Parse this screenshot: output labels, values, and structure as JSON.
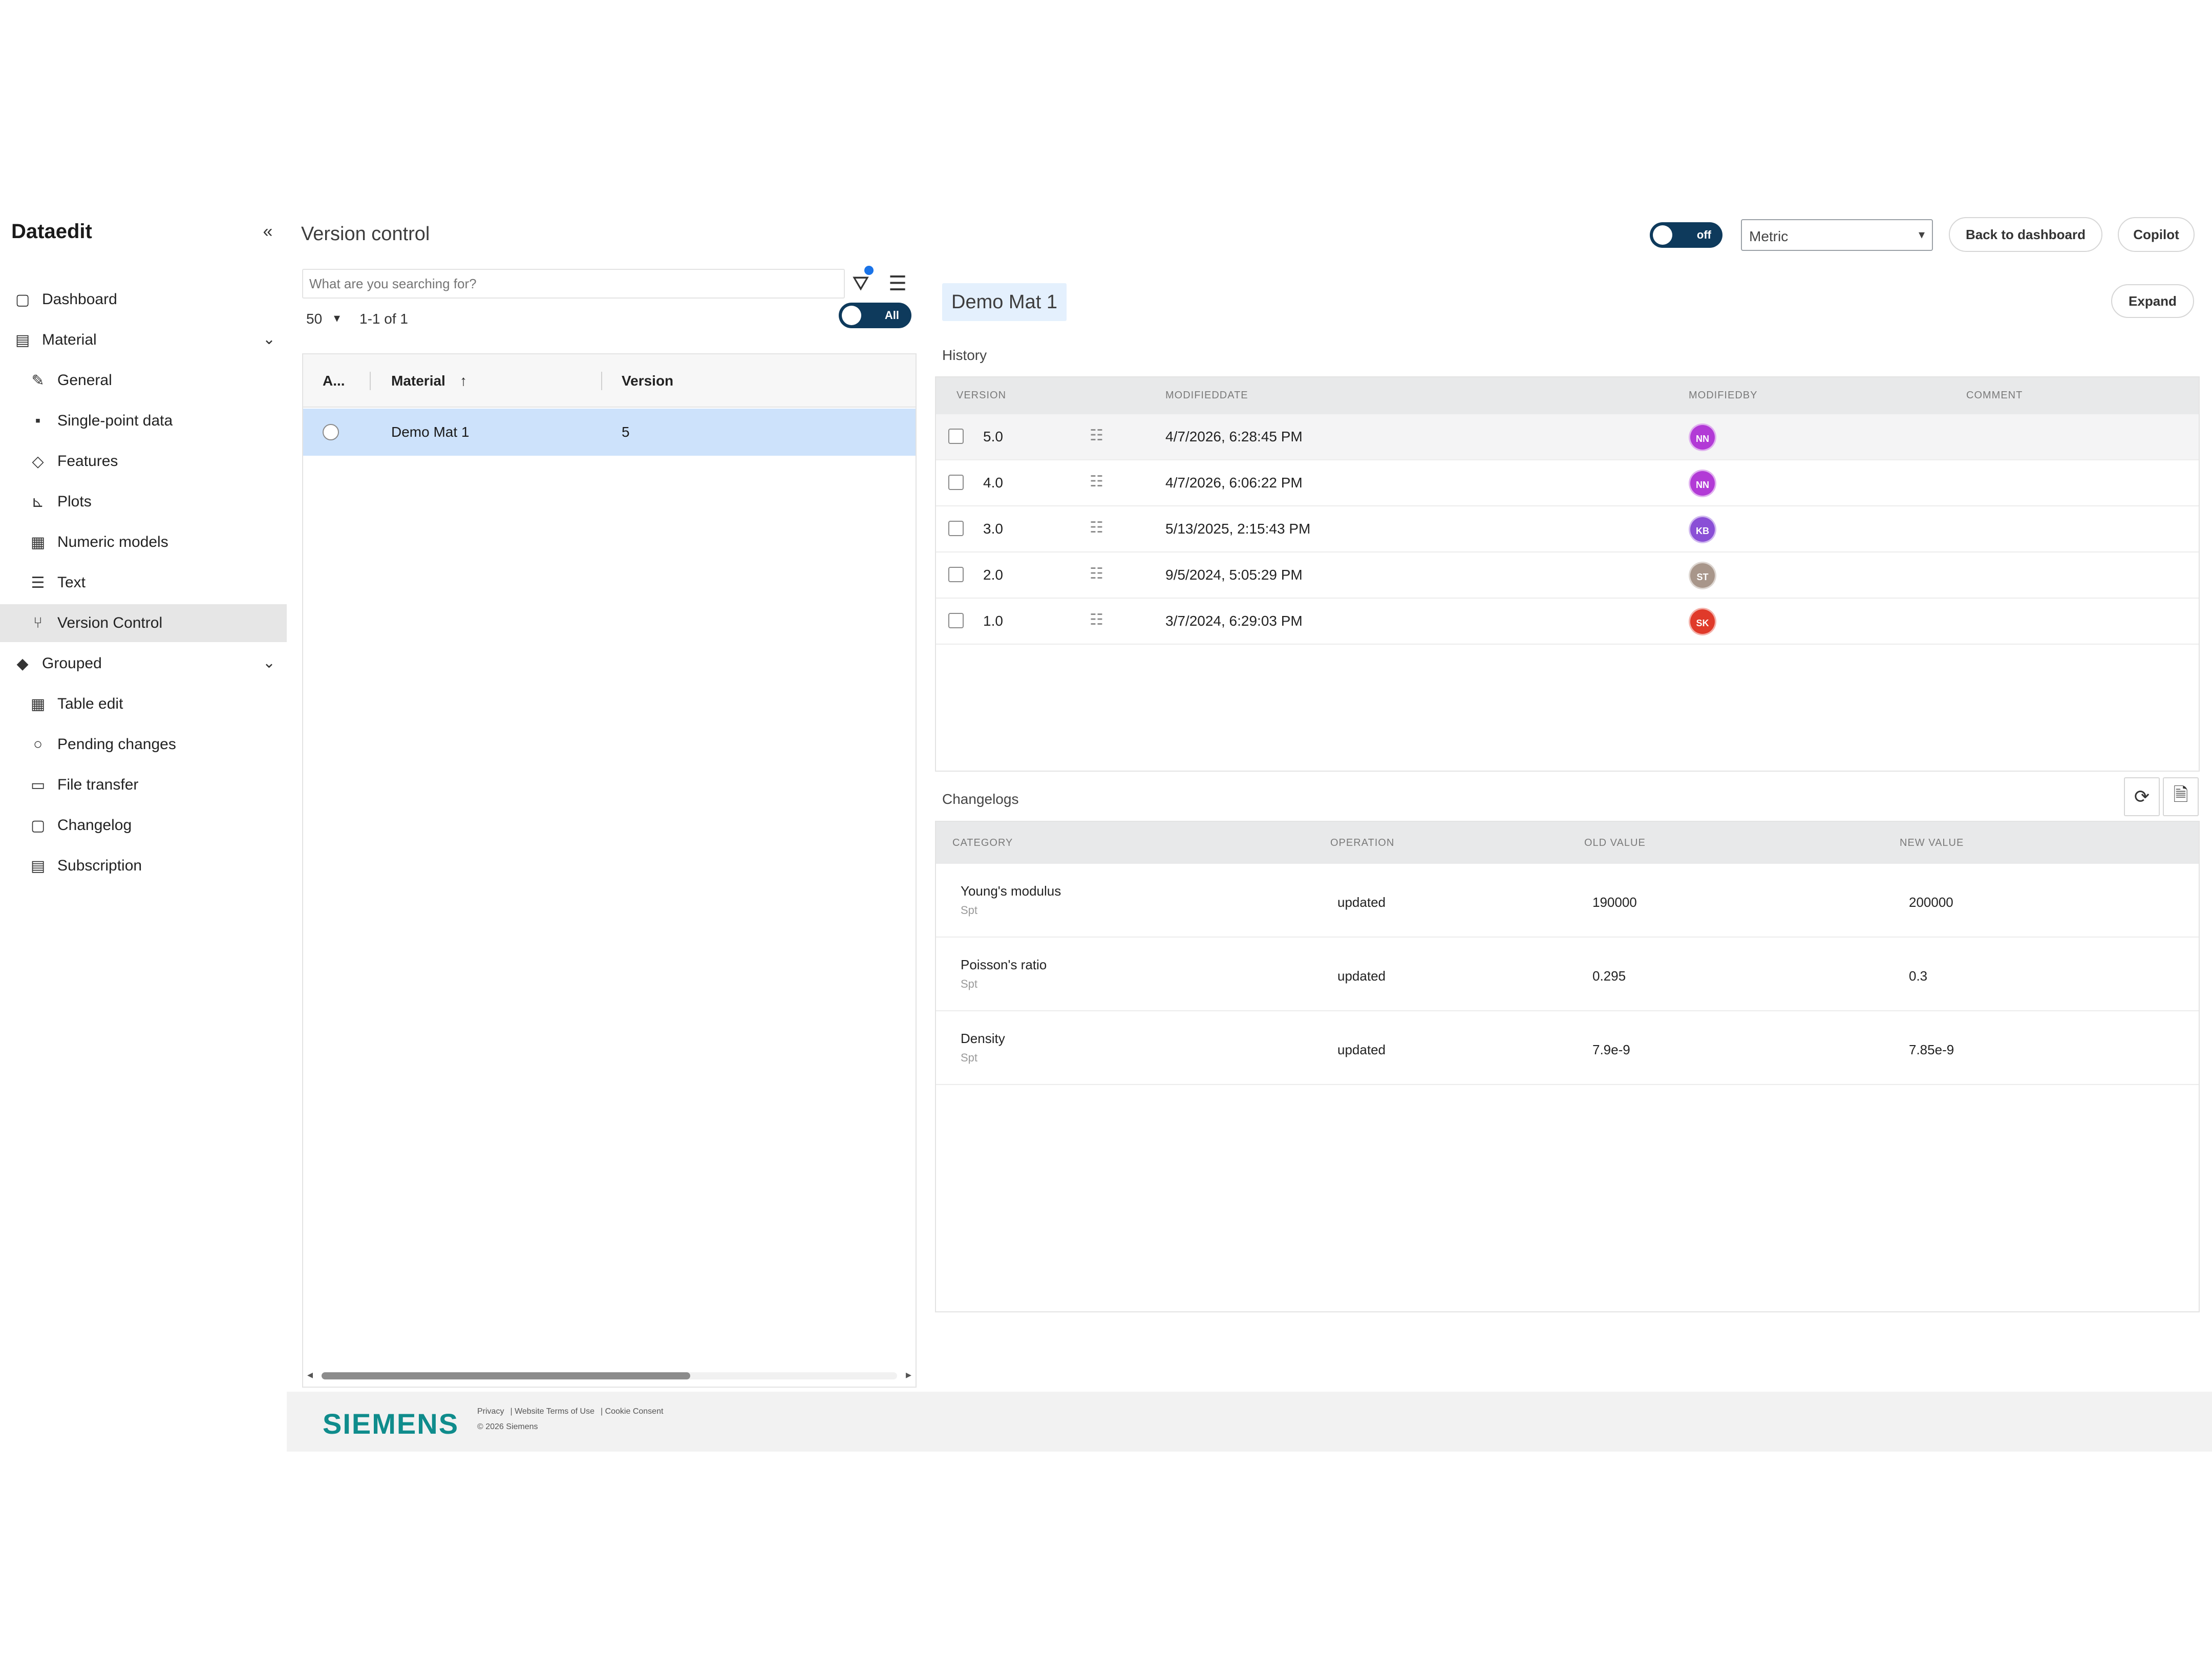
{
  "app": {
    "brand": "Dataedit",
    "collapse_icon": "double-chevron-left-icon"
  },
  "sidebar": {
    "items": [
      {
        "label": "Dashboard",
        "icon": "dashboard-icon",
        "level": "top"
      },
      {
        "label": "Material",
        "icon": "material-icon",
        "level": "top",
        "expandable": true
      },
      {
        "label": "General",
        "icon": "pencil-icon",
        "level": "sub"
      },
      {
        "label": "Single-point data",
        "icon": "point-icon",
        "level": "sub"
      },
      {
        "label": "Features",
        "icon": "tag-icon",
        "level": "sub"
      },
      {
        "label": "Plots",
        "icon": "plot-icon",
        "level": "sub"
      },
      {
        "label": "Numeric models",
        "icon": "numeric-icon",
        "level": "sub"
      },
      {
        "label": "Text",
        "icon": "text-icon",
        "level": "sub"
      },
      {
        "label": "Version Control",
        "icon": "branch-icon",
        "level": "sub",
        "active": true
      },
      {
        "label": "Grouped",
        "icon": "group-icon",
        "level": "top",
        "expandable": true
      },
      {
        "label": "Table edit",
        "icon": "table-icon",
        "level": "sub"
      },
      {
        "label": "Pending changes",
        "icon": "pending-icon",
        "level": "sub"
      },
      {
        "label": "File transfer",
        "icon": "folder-icon",
        "level": "sub"
      },
      {
        "label": "Changelog",
        "icon": "changelog-icon",
        "level": "sub"
      },
      {
        "label": "Subscription",
        "icon": "subscription-icon",
        "level": "sub"
      }
    ]
  },
  "header": {
    "title": "Version control",
    "toggle_label": "off",
    "unit_select": "Metric",
    "back_button": "Back to dashboard",
    "copilot_button": "Copilot"
  },
  "list": {
    "search_placeholder": "What are you searching for?",
    "page_size": "50",
    "range": "1-1 of 1",
    "all_toggle": "All",
    "columns": [
      "A...",
      "Material",
      "Version"
    ],
    "sort_indicator": "↑",
    "rows": [
      {
        "material": "Demo Mat 1",
        "version": "5"
      }
    ]
  },
  "detail": {
    "title": "Demo Mat 1",
    "expand_button": "Expand",
    "history_label": "History",
    "history_columns": [
      "VERSION",
      "MODIFIEDDATE",
      "MODIFIEDBY",
      "COMMENT"
    ],
    "history": [
      {
        "version": "5.0",
        "date": "4/7/2026, 6:28:45 PM",
        "initials": "NN",
        "color": "#b23ad6"
      },
      {
        "version": "4.0",
        "date": "4/7/2026, 6:06:22 PM",
        "initials": "NN",
        "color": "#b23ad6"
      },
      {
        "version": "3.0",
        "date": "5/13/2025, 2:15:43 PM",
        "initials": "KB",
        "color": "#8a4fd6"
      },
      {
        "version": "2.0",
        "date": "9/5/2024, 5:05:29 PM",
        "initials": "ST",
        "color": "#a8968a"
      },
      {
        "version": "1.0",
        "date": "3/7/2024, 6:29:03 PM",
        "initials": "SK",
        "color": "#e03a2a"
      }
    ],
    "changelogs_label": "Changelogs",
    "changelog_tools": [
      "refresh-icon",
      "export-icon"
    ],
    "changelog_columns": [
      "CATEGORY",
      "OPERATION",
      "OLD VALUE",
      "NEW VALUE"
    ],
    "changelogs": [
      {
        "category": "Young's modulus",
        "sub": "Spt",
        "operation": "updated",
        "old": "190000",
        "new": "200000"
      },
      {
        "category": "Poisson's ratio",
        "sub": "Spt",
        "operation": "updated",
        "old": "0.295",
        "new": "0.3"
      },
      {
        "category": "Density",
        "sub": "Spt",
        "operation": "updated",
        "old": "7.9e-9",
        "new": "7.85e-9"
      }
    ]
  },
  "footer": {
    "logo": "SIEMENS",
    "links": [
      "Privacy",
      "Website Terms of Use",
      "Cookie Consent"
    ],
    "copyright": "© 2026 Siemens"
  }
}
